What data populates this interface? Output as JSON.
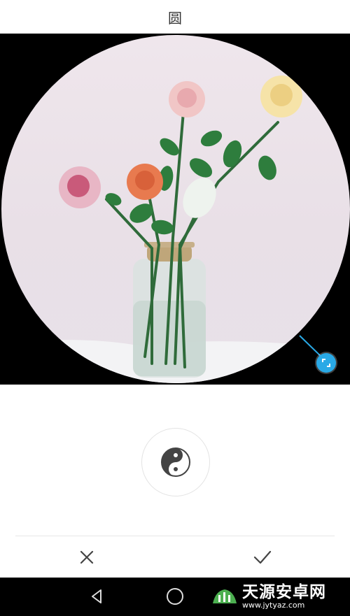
{
  "header": {
    "title": "圆"
  },
  "editor": {
    "image_description_icon": "rose-vase-photo",
    "accent_color": "#29a9e6",
    "mode_icon": "yin-yang-icon"
  },
  "actions": {
    "cancel_icon": "close-icon",
    "confirm_icon": "check-icon"
  },
  "navbar": {
    "back_icon": "back-triangle-icon",
    "home_icon": "home-circle-icon"
  },
  "watermark": {
    "name": "天源安卓网",
    "url": "www.jytyaz.com"
  }
}
